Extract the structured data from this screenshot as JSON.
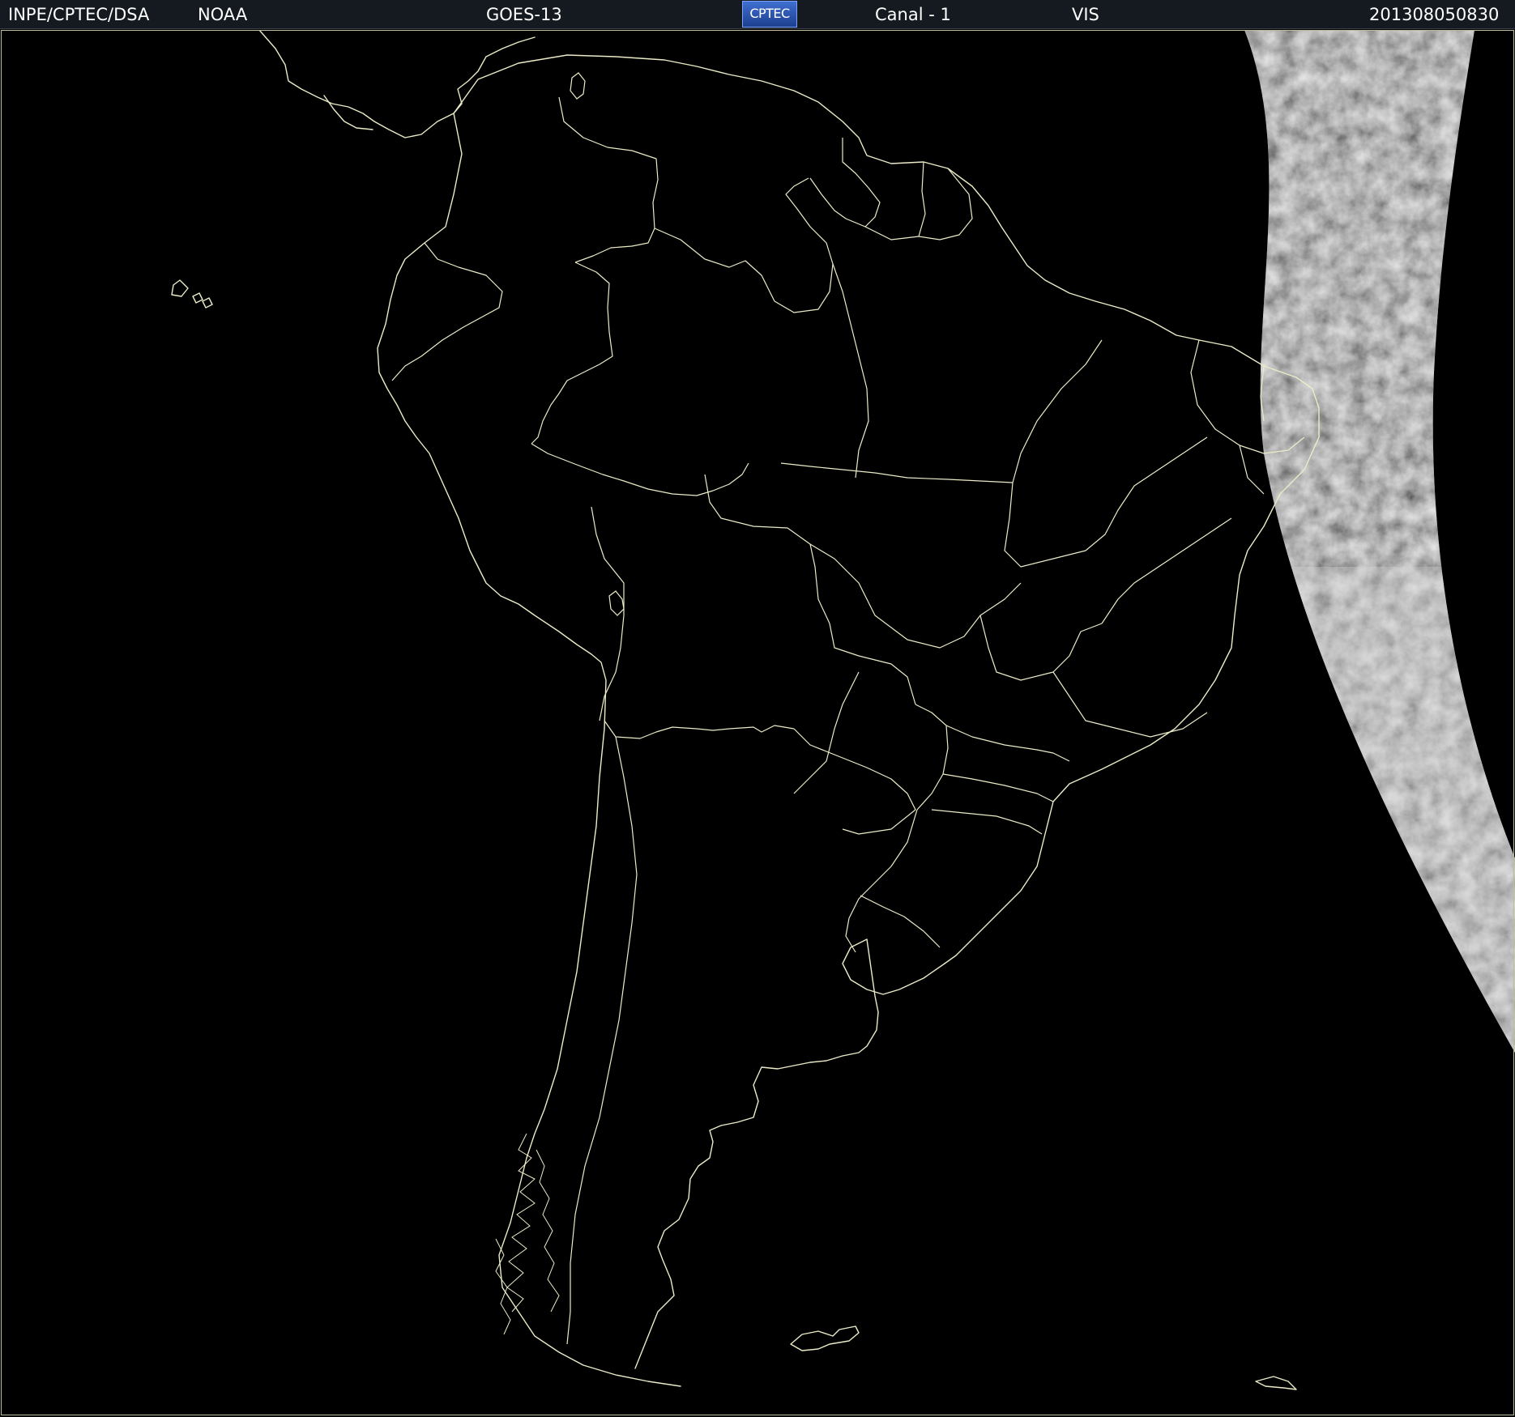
{
  "header": {
    "institution": "INPE/CPTEC/DSA",
    "agency": "NOAA",
    "satellite": "GOES-13",
    "logo_text": "CPTEC",
    "channel": "Canal - 1",
    "band": "VIS",
    "timestamp": "201308050830"
  },
  "colors": {
    "background": "#000000",
    "header_bg": "#141a20",
    "outline": "#ecebc8",
    "cloud_light": "#d9d9d9",
    "cloud_dark": "#6f6f6f"
  }
}
